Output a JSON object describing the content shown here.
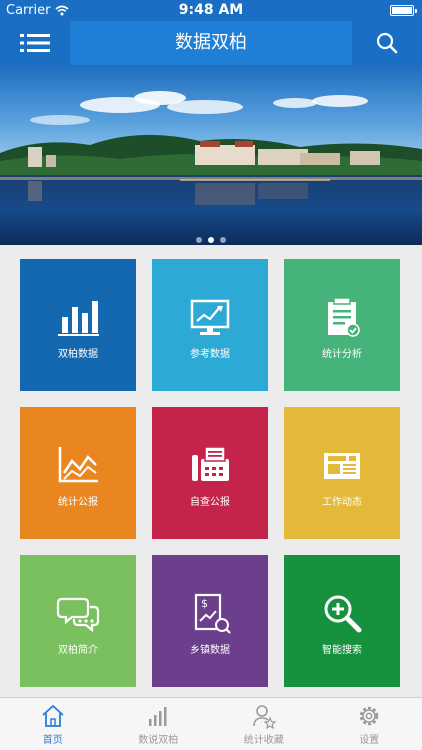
{
  "status_bar": {
    "carrier": "Carrier",
    "time": "9:48 AM"
  },
  "nav": {
    "title": "数据双柏",
    "menu_icon": "menu-icon",
    "search_icon": "search-icon"
  },
  "banner": {
    "slides": 3,
    "active_slide": 2
  },
  "tiles": [
    {
      "label": "双柏数据",
      "icon": "bar-chart-icon",
      "color": "#1468b0"
    },
    {
      "label": "参考数据",
      "icon": "monitor-chart-icon",
      "color": "#2da9d6"
    },
    {
      "label": "统计分析",
      "icon": "clipboard-check-icon",
      "color": "#46b47a"
    },
    {
      "label": "统计公报",
      "icon": "line-chart-icon",
      "color": "#ea8620"
    },
    {
      "label": "自查公报",
      "icon": "fax-icon",
      "color": "#c4244a"
    },
    {
      "label": "工作动态",
      "icon": "newspaper-icon",
      "color": "#e4b838"
    },
    {
      "label": "双柏简介",
      "icon": "chat-bubbles-icon",
      "color": "#7ac05e"
    },
    {
      "label": "乡镇数据",
      "icon": "document-chart-icon",
      "color": "#6b3f8c"
    },
    {
      "label": "智能搜索",
      "icon": "zoom-in-icon",
      "color": "#16923e"
    }
  ],
  "tabs": [
    {
      "label": "首页",
      "icon": "home-icon",
      "active": true
    },
    {
      "label": "数说双柏",
      "icon": "bars-icon",
      "active": false
    },
    {
      "label": "统计收藏",
      "icon": "user-star-icon",
      "active": false
    },
    {
      "label": "设置",
      "icon": "gear-icon",
      "active": false
    }
  ],
  "colors": {
    "nav": "#1f7fd6",
    "nav_dark": "#1a6fc4",
    "tab_active": "#2a7fd8"
  }
}
